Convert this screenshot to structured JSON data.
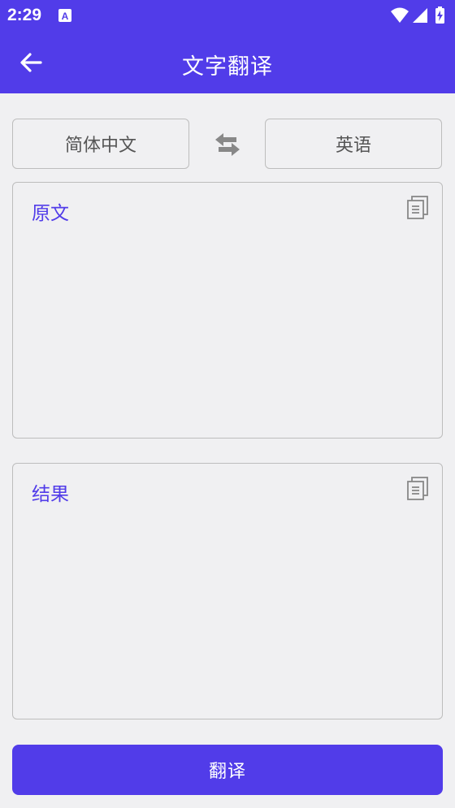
{
  "status_bar": {
    "time": "2:29",
    "icons": [
      "notification-a-icon",
      "wifi-icon",
      "signal-icon",
      "battery-charging-icon"
    ]
  },
  "app_bar": {
    "title": "文字翻译",
    "back_icon": "arrow-left-icon"
  },
  "languages": {
    "source": "简体中文",
    "target": "英语",
    "swap_icon": "swap-arrows-icon"
  },
  "source_box": {
    "label": "原文",
    "copy_icon": "copy-icon"
  },
  "result_box": {
    "label": "结果",
    "copy_icon": "copy-icon"
  },
  "actions": {
    "translate_label": "翻译"
  },
  "colors": {
    "accent": "#513ce9",
    "background": "#f0f0f2",
    "border": "#bdbdbd",
    "icon_gray": "#888888"
  }
}
